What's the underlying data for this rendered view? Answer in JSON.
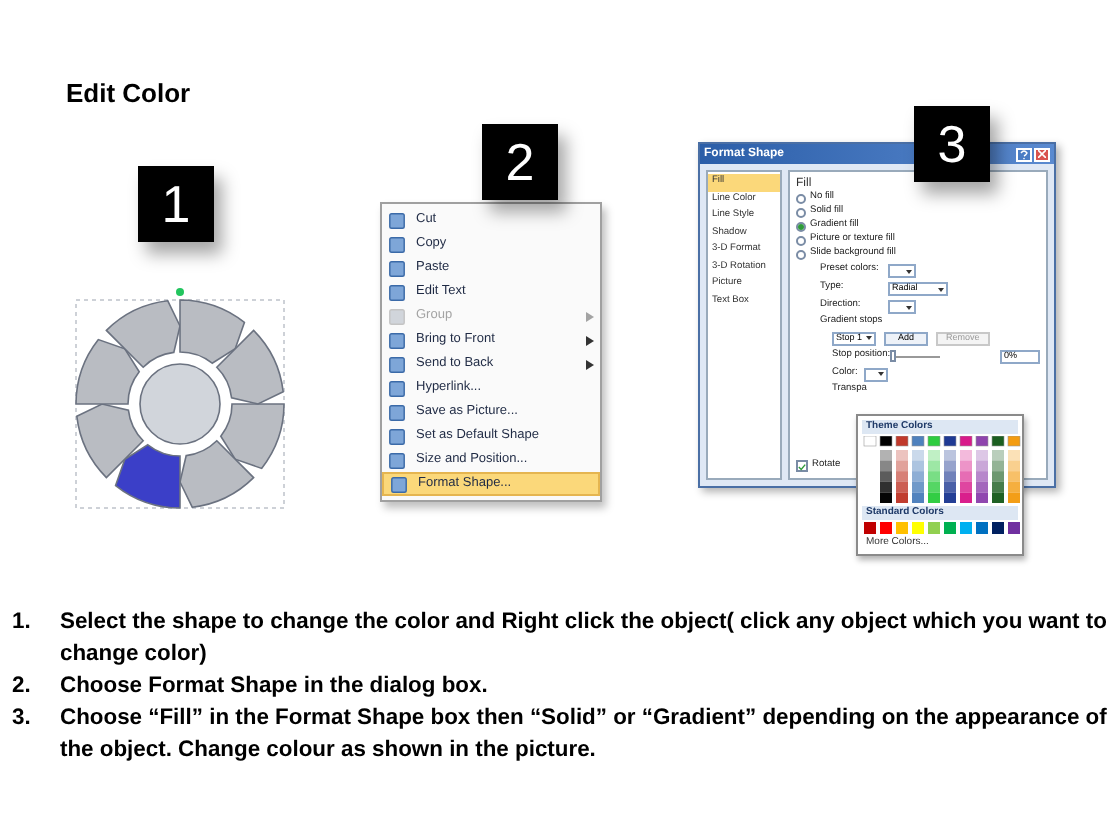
{
  "title": "Edit Color",
  "badges": [
    "1",
    "2",
    "3"
  ],
  "context_menu": {
    "items": [
      {
        "label": "Cut",
        "disabled": false,
        "submenu": false,
        "selected": false
      },
      {
        "label": "Copy",
        "disabled": false,
        "submenu": false,
        "selected": false
      },
      {
        "label": "Paste",
        "disabled": false,
        "submenu": false,
        "selected": false
      },
      {
        "label": "Edit Text",
        "disabled": false,
        "submenu": false,
        "selected": false
      },
      {
        "label": "Group",
        "disabled": true,
        "submenu": true,
        "selected": false
      },
      {
        "label": "Bring to Front",
        "disabled": false,
        "submenu": true,
        "selected": false
      },
      {
        "label": "Send to Back",
        "disabled": false,
        "submenu": true,
        "selected": false
      },
      {
        "label": "Hyperlink...",
        "disabled": false,
        "submenu": false,
        "selected": false
      },
      {
        "label": "Save as Picture...",
        "disabled": false,
        "submenu": false,
        "selected": false
      },
      {
        "label": "Set as Default Shape",
        "disabled": false,
        "submenu": false,
        "selected": false
      },
      {
        "label": "Size and Position...",
        "disabled": false,
        "submenu": false,
        "selected": false
      },
      {
        "label": "Format Shape...",
        "disabled": false,
        "submenu": false,
        "selected": true
      }
    ]
  },
  "format_dialog": {
    "title": "Format Shape",
    "categories": [
      {
        "label": "Fill",
        "selected": true
      },
      {
        "label": "Line Color",
        "selected": false
      },
      {
        "label": "Line Style",
        "selected": false
      },
      {
        "label": "Shadow",
        "selected": false
      },
      {
        "label": "3-D Format",
        "selected": false
      },
      {
        "label": "3-D Rotation",
        "selected": false
      },
      {
        "label": "Picture",
        "selected": false
      },
      {
        "label": "Text Box",
        "selected": false
      }
    ],
    "heading": "Fill",
    "fill_options": [
      {
        "label": "No fill",
        "selected": false
      },
      {
        "label": "Solid fill",
        "selected": false
      },
      {
        "label": "Gradient fill",
        "selected": true
      },
      {
        "label": "Picture or texture fill",
        "selected": false
      },
      {
        "label": "Slide background fill",
        "selected": false
      }
    ],
    "preset_label": "Preset colors:",
    "type_label": "Type:",
    "type_value": "Radial",
    "direction_label": "Direction:",
    "stops_label": "Gradient stops",
    "stop_value": "Stop 1",
    "add_button": "Add",
    "remove_button": "Remove",
    "position_label": "Stop position:",
    "position_slider": {
      "level": 0
    },
    "position_value": "0%",
    "color_label": "Color:",
    "transparency_label": "Transpa",
    "rotate": {
      "label": "Rotate",
      "checked": true
    },
    "color_popup": {
      "theme_heading": "Theme Colors",
      "standard_heading": "Standard Colors",
      "more": "More Colors..."
    }
  },
  "instructions": [
    {
      "number": "1.",
      "text": "Select the shape to change the color and Right click the object( click any object which you want to change color)"
    },
    {
      "number": "2.",
      "text": "Choose Format Shape in the dialog box."
    },
    {
      "number": "3.",
      "text": "Choose “Fill” in the Format Shape box then “Solid” or “Gradient” depending on the appearance of the object. Change colour as shown in the picture."
    }
  ]
}
